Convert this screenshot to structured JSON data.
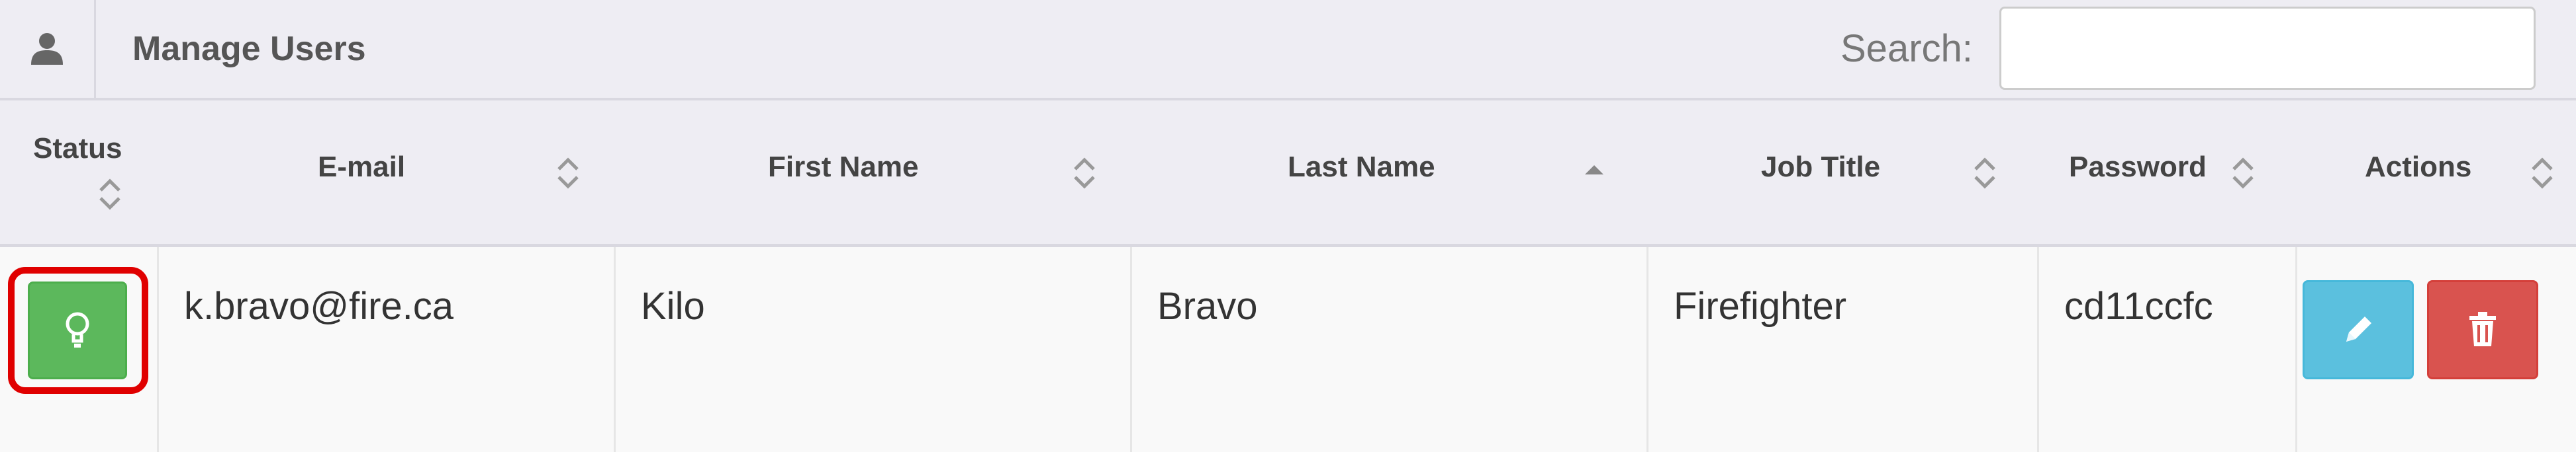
{
  "header": {
    "title": "Manage Users",
    "icon": "user-icon",
    "search_label": "Search:",
    "search_value": "",
    "search_placeholder": ""
  },
  "columns": [
    {
      "label": "Status",
      "sort": "both"
    },
    {
      "label": "E-mail",
      "sort": "both"
    },
    {
      "label": "First Name",
      "sort": "both"
    },
    {
      "label": "Last Name",
      "sort": "ascending"
    },
    {
      "label": "Job Title",
      "sort": "both"
    },
    {
      "label": "Password",
      "sort": "both"
    },
    {
      "label": "Actions",
      "sort": "both"
    }
  ],
  "rows": [
    {
      "status": "active",
      "status_icon": "lightbulb-icon",
      "email": "k.bravo@fire.ca",
      "first_name": "Kilo",
      "last_name": "Bravo",
      "job_title": "Firefighter",
      "password": "cd11ccfc",
      "actions": [
        "pencil-icon",
        "trash-icon"
      ]
    }
  ],
  "colors": {
    "status_active": "#5cb85c",
    "edit": "#5bc0de",
    "delete": "#d9534f",
    "highlight": "#e00000",
    "header_bg": "#eeedf3"
  }
}
